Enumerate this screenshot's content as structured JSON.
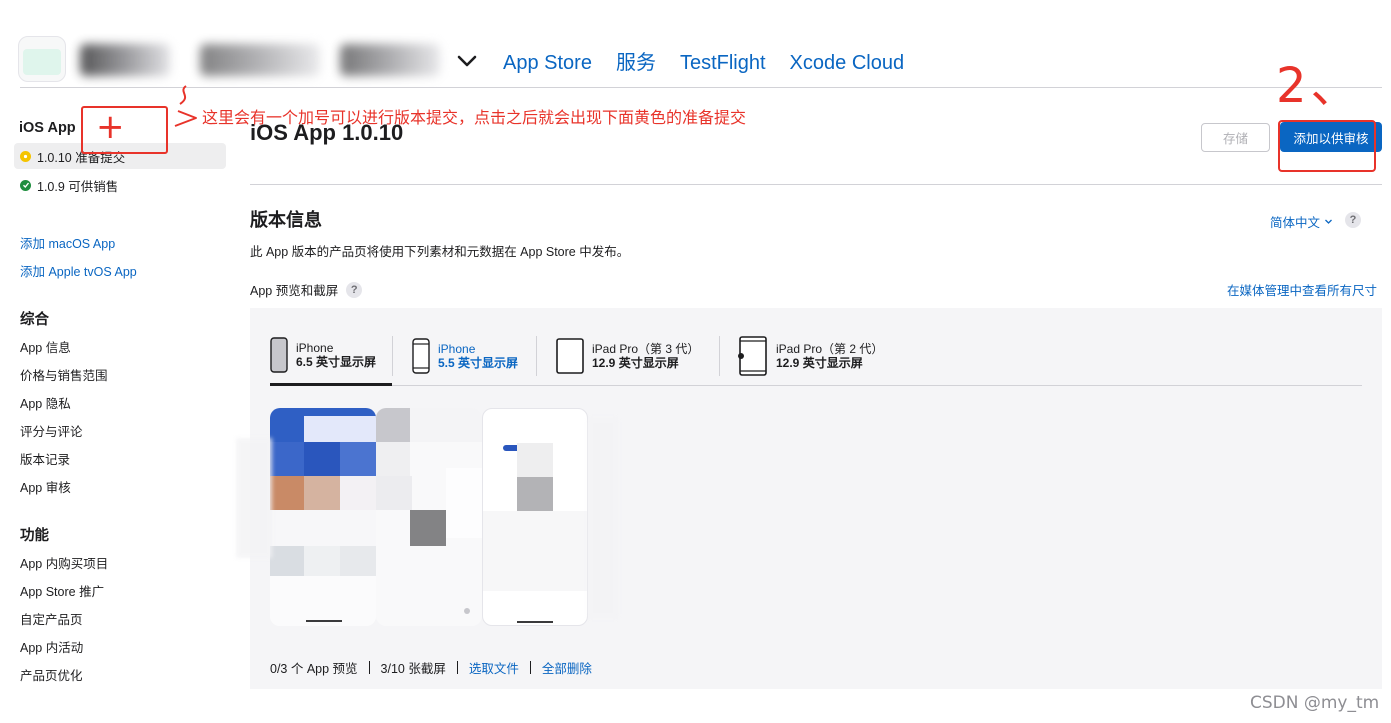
{
  "colors": {
    "accent": "#0a66c2",
    "annotation": "#e8332a",
    "ready_dot": "#f5c400",
    "sale_dot": "#1e8e3e"
  },
  "app": {
    "icon": "app-icon",
    "name_icon": "chevron-down-icon"
  },
  "top_nav": {
    "tabs": [
      {
        "label": "App Store"
      },
      {
        "label": "服务"
      },
      {
        "label": "TestFlight"
      },
      {
        "label": "Xcode Cloud"
      }
    ]
  },
  "sidebar": {
    "platform": "iOS App",
    "versions": [
      {
        "label": "1.0.10 准备提交",
        "status": "ready",
        "icon": "yellow-dot-icon"
      },
      {
        "label": "1.0.9 可供销售",
        "status": "available",
        "icon": "green-check-icon"
      }
    ],
    "add_links": [
      {
        "label": "添加 macOS App"
      },
      {
        "label": "添加 Apple tvOS App"
      }
    ],
    "general": {
      "heading": "综合",
      "items": [
        {
          "label": "App 信息"
        },
        {
          "label": "价格与销售范围"
        },
        {
          "label": "App 隐私"
        },
        {
          "label": "评分与评论"
        },
        {
          "label": "版本记录"
        },
        {
          "label": "App 审核"
        }
      ]
    },
    "features": {
      "heading": "功能",
      "items": [
        {
          "label": "App 内购买项目"
        },
        {
          "label": "App Store 推广"
        },
        {
          "label": "自定产品页"
        },
        {
          "label": "App 内活动"
        },
        {
          "label": "产品页优化"
        }
      ]
    }
  },
  "main": {
    "title": "iOS App 1.0.10",
    "save_label": "存储",
    "submit_label": "添加以供审核",
    "version_info": {
      "heading": "版本信息",
      "language": "简体中文",
      "help": "?",
      "description": "此 App 版本的产品页将使用下列素材和元数据在 App Store 中发布。"
    },
    "previews": {
      "label": "App 预览和截屏",
      "help": "?",
      "media_link": "在媒体管理中查看所有尺寸",
      "devices": [
        {
          "name": "iPhone",
          "size": "6.5 英寸显示屏",
          "icon": "iphone-icon",
          "active": true
        },
        {
          "name": "iPhone",
          "size": "5.5 英寸显示屏",
          "icon": "iphone-home-button-icon",
          "selected": true
        },
        {
          "name": "iPad Pro（第 3 代）",
          "size": "12.9 英寸显示屏",
          "icon": "ipad-pro-icon"
        },
        {
          "name": "iPad Pro（第 2 代）",
          "size": "12.9 英寸显示屏",
          "icon": "ipad-pro-home-button-icon"
        }
      ],
      "footer": {
        "previews_count": "0/3 个 App 预览",
        "screens_count": "3/10 张截屏",
        "choose_file": "选取文件",
        "delete_all": "全部删除"
      }
    }
  },
  "annotations": {
    "plus": "+",
    "note": "这里会有一个加号可以进行版本提交，点击之后就会出现下面黄色的准备提交",
    "step": "2、"
  },
  "watermark": "CSDN @my_tm"
}
